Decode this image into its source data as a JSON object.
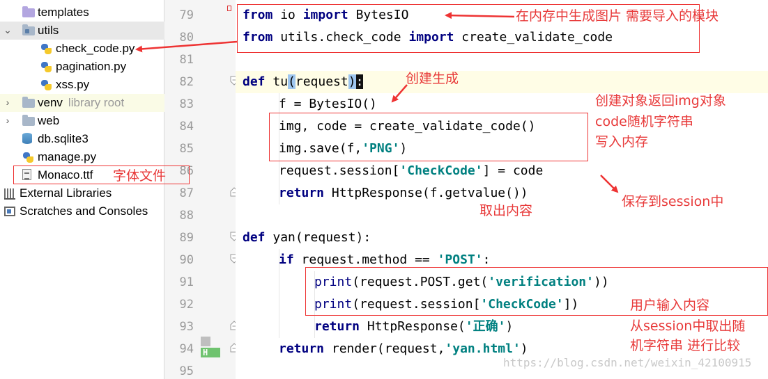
{
  "project_tree": {
    "items": [
      {
        "label": "templates",
        "suffix": ""
      },
      {
        "label": "utils",
        "suffix": ""
      },
      {
        "label": "check_code.py",
        "suffix": ""
      },
      {
        "label": "pagination.py",
        "suffix": ""
      },
      {
        "label": "xss.py",
        "suffix": ""
      },
      {
        "label": "venv",
        "suffix": "library root"
      },
      {
        "label": "web",
        "suffix": ""
      },
      {
        "label": "db.sqlite3",
        "suffix": ""
      },
      {
        "label": "manage.py",
        "suffix": ""
      },
      {
        "label": "Monaco.ttf",
        "suffix": ""
      },
      {
        "label": "External Libraries",
        "suffix": ""
      },
      {
        "label": "Scratches and Consoles",
        "suffix": ""
      }
    ]
  },
  "editor": {
    "line_numbers": [
      "79",
      "80",
      "81",
      "82",
      "83",
      "84",
      "85",
      "86",
      "87",
      "88",
      "89",
      "90",
      "91",
      "92",
      "93",
      "94",
      "95"
    ],
    "bookmark_label": "H",
    "code": {
      "l79": {
        "kw1": "from",
        "mod": " io ",
        "kw2": "import",
        "name": " BytesIO"
      },
      "l80": {
        "kw1": "from",
        "mod": " utils.check_code ",
        "kw2": "import",
        "name": " create_validate_code"
      },
      "l82": {
        "kw": "def",
        "name": " tu",
        "open": "(",
        "param": "request",
        "close": ")",
        "colon": ":"
      },
      "l83": {
        "text": "f = BytesIO()"
      },
      "l84": {
        "text": "img, code = create_validate_code()"
      },
      "l85": {
        "pre": "img.save(f,",
        "str": "'PNG'",
        "post": ")"
      },
      "l86": {
        "pre": "request.session[",
        "str": "'CheckCode'",
        "post": "] = code"
      },
      "l87": {
        "kw": "return",
        "post": " HttpResponse(f.getvalue())"
      },
      "l89": {
        "kw": "def",
        "post": " yan(request):"
      },
      "l90": {
        "kw": "if",
        "pre": " request.method == ",
        "str": "'POST'",
        "post": ":"
      },
      "l91": {
        "fn": "print",
        "pre": "(request.POST.get(",
        "str": "'verification'",
        "post": "))"
      },
      "l92": {
        "fn": "print",
        "pre": "(request.session[",
        "str": "'CheckCode'",
        "post": "])"
      },
      "l93": {
        "kw": "return",
        "pre": " HttpResponse(",
        "str": "'正确'",
        "post": ")"
      },
      "l94": {
        "kw": "return",
        "pre": " render(request,",
        "str": "'yan.html'",
        "post": ")"
      }
    }
  },
  "annotations": {
    "import_note": "在内存中生成图片 需要导入的模块",
    "create_note": "创建生成",
    "object_note_1": "创建对象返回img对象",
    "object_note_2": "code随机字符串",
    "object_note_3": "写入内存",
    "session_note": "保存到session中",
    "getvalue_note": "取出内容",
    "font_note": "字体文件",
    "user_input_note": "用户输入内容",
    "compare_note_1": "从session中取出随",
    "compare_note_2": "机字符串 进行比较"
  },
  "watermark": "https://blog.csdn.net/weixin_42100915",
  "colors": {
    "annotation": "#e83a3a",
    "keyword": "#000080",
    "string": "#008080"
  }
}
